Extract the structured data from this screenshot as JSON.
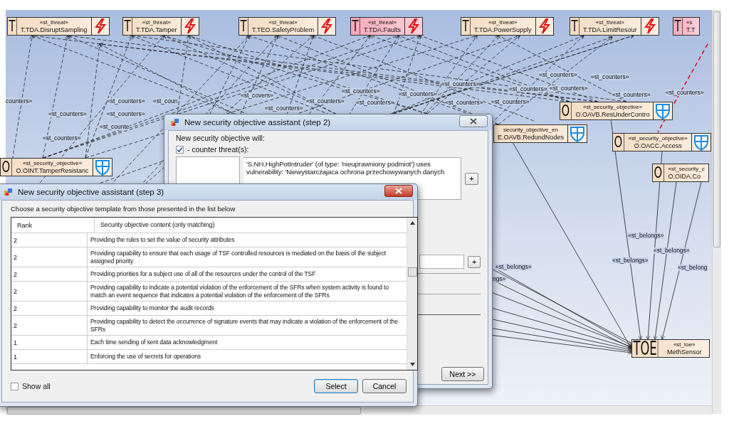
{
  "diagram": {
    "threats": [
      {
        "letter": "T",
        "stereotype": "«st_threat»",
        "name": "T.TDA.DisruptSampling",
        "highlighted": false,
        "kind": "full"
      },
      {
        "letter": "T",
        "stereotype": "«st_threat»",
        "name": "T.TDA.Tamper",
        "highlighted": false,
        "kind": "full"
      },
      {
        "letter": "T",
        "stereotype": "«st_threat»",
        "name": "T.TEO.SafetyProblem",
        "highlighted": false,
        "kind": "full"
      },
      {
        "letter": "T",
        "stereotype": "«st_threat»",
        "name": "T.TDA.Faults",
        "highlighted": true,
        "kind": "full"
      },
      {
        "letter": "T",
        "stereotype": "«st_threat»",
        "name": "T.TDA.PowerSupply",
        "highlighted": false,
        "kind": "full"
      },
      {
        "letter": "T",
        "stereotype": "«st_threat»",
        "name": "T.TDA.LimitResour",
        "highlighted": false,
        "kind": "full"
      },
      {
        "letter": "T",
        "stereotype": "«s",
        "name": "T.T",
        "highlighted": true,
        "kind": "cut_right"
      }
    ],
    "objectives": [
      {
        "letter": "O",
        "stereotype": "«st_security_objective»",
        "name": "O.OINT.TamperResistanc",
        "kind": "full"
      },
      {
        "letter": "O",
        "stereotype": "«st_security_objective»",
        "name": "O.OAVB.ResUnderContro",
        "kind": "full"
      },
      {
        "stereotype": "security_objective_en",
        "name": "E.OAVB.RedundNodes",
        "kind": "cut_left"
      },
      {
        "letter": "O",
        "stereotype": "«st_security_objective»",
        "name": "O.OACC.Access",
        "kind": "full"
      },
      {
        "letter": "O",
        "stereotype": "«st_security_c",
        "name": "O.OIDA.Co",
        "kind": "cut_right"
      }
    ],
    "toe": {
      "letter": "TOE",
      "stereotype": "«st_toe»",
      "name": "MethSensor"
    },
    "edge_labels": [
      "counters»",
      "«st_counters»",
      "«st_counters»",
      "«st_counters»",
      "«st_counte",
      "«st_counters»",
      "«st_coun",
      "«st_covers»",
      "«st_counters»",
      "«st_counters»",
      "«st_counters»",
      "«st_counters»",
      "«st_counters»",
      "«st_counters»",
      "«st_counters»",
      "«st_counters»",
      "«st_counters»",
      "«st_counters»",
      "«st_counters»",
      "«st_counters»",
      "«st_counters»",
      "«st_counters»",
      "«st_belongs»",
      "ngs»",
      "«st_belongs»",
      "«st_belongs»",
      "«st_belongs»",
      "«st_belong"
    ]
  },
  "step2": {
    "title": "New security objective assistant (step 2)",
    "intro": "New security objective will:",
    "counter_threats": {
      "label": "- counter threat(s):",
      "checked": true
    },
    "threat_description": "'S.NH.HighPotIntruder' (of type: 'nieuprawniony podmiot') uses vulnerability: 'Niewystarczajaca ochrona przechowywanych danych",
    "add_buttons": [
      "+",
      "+"
    ],
    "next_button": "Next >>"
  },
  "step3": {
    "title": "New security objective assistant (step 3)",
    "instruction": "Choose a security objective template from those presented in the list below",
    "columns": [
      "Rank",
      "Security objective content (only matching)"
    ],
    "rows": [
      {
        "rank": "2",
        "content": "Providing the rules to set the value of security attributes"
      },
      {
        "rank": "2",
        "content": "Providing capability to ensure that each usage of TSF controlled resources is mediated on the basis of the subject assigned priority"
      },
      {
        "rank": "2",
        "content": "Providing priorities for a subject use of all of the resources under the control of the TSF"
      },
      {
        "rank": "2",
        "content": "Providing capability to indicate a potential violation of the enforcement of the SFRs when system activity is found to match an event sequence that indicates a potential violation of the enforcement of the SFRs"
      },
      {
        "rank": "2",
        "content": "Providing capability to monitor the audit records"
      },
      {
        "rank": "2",
        "content": "Providing capability to detect the occurrence of signature events that may indicate a violation of the enforcement of the SFRs"
      },
      {
        "rank": "1",
        "content": "Each time sending of sent data acknowledgment"
      },
      {
        "rank": "1",
        "content": "Enforcing the use of secrets for operations"
      }
    ],
    "show_all": {
      "label": "Show all",
      "checked": false
    },
    "buttons": [
      "Select",
      "Cancel"
    ]
  }
}
